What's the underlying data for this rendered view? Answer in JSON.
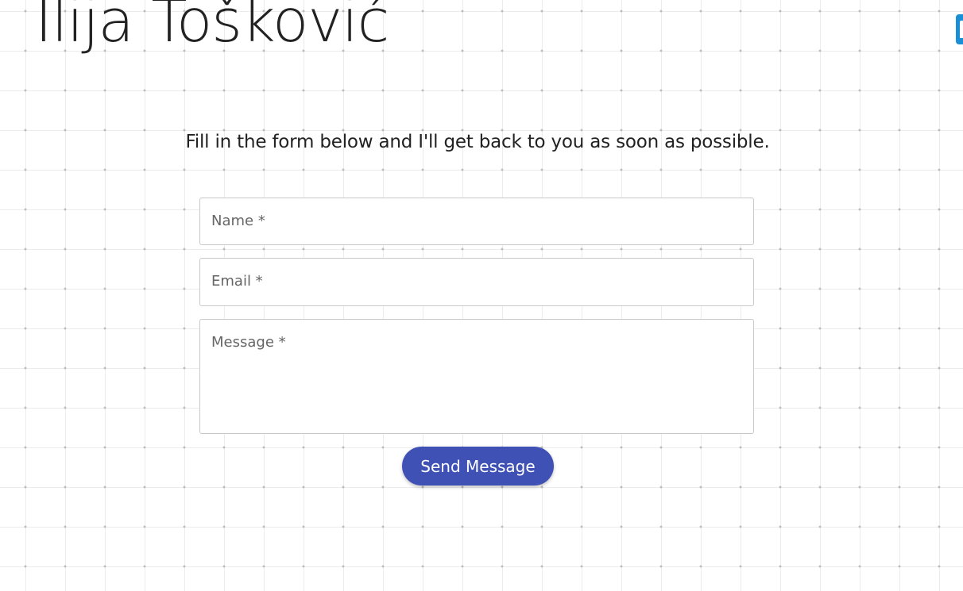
{
  "header": {
    "title": "Ilija Tošković",
    "social_icon": "facebook-icon"
  },
  "contact": {
    "intro": "Fill in the form below and I'll get back to you as soon as possible.",
    "name_placeholder": "Name *",
    "email_placeholder": "Email *",
    "message_placeholder": "Message *",
    "send_label": "Send Message"
  },
  "colors": {
    "accent": "#3f51b5",
    "social": "#1b8fd6"
  }
}
